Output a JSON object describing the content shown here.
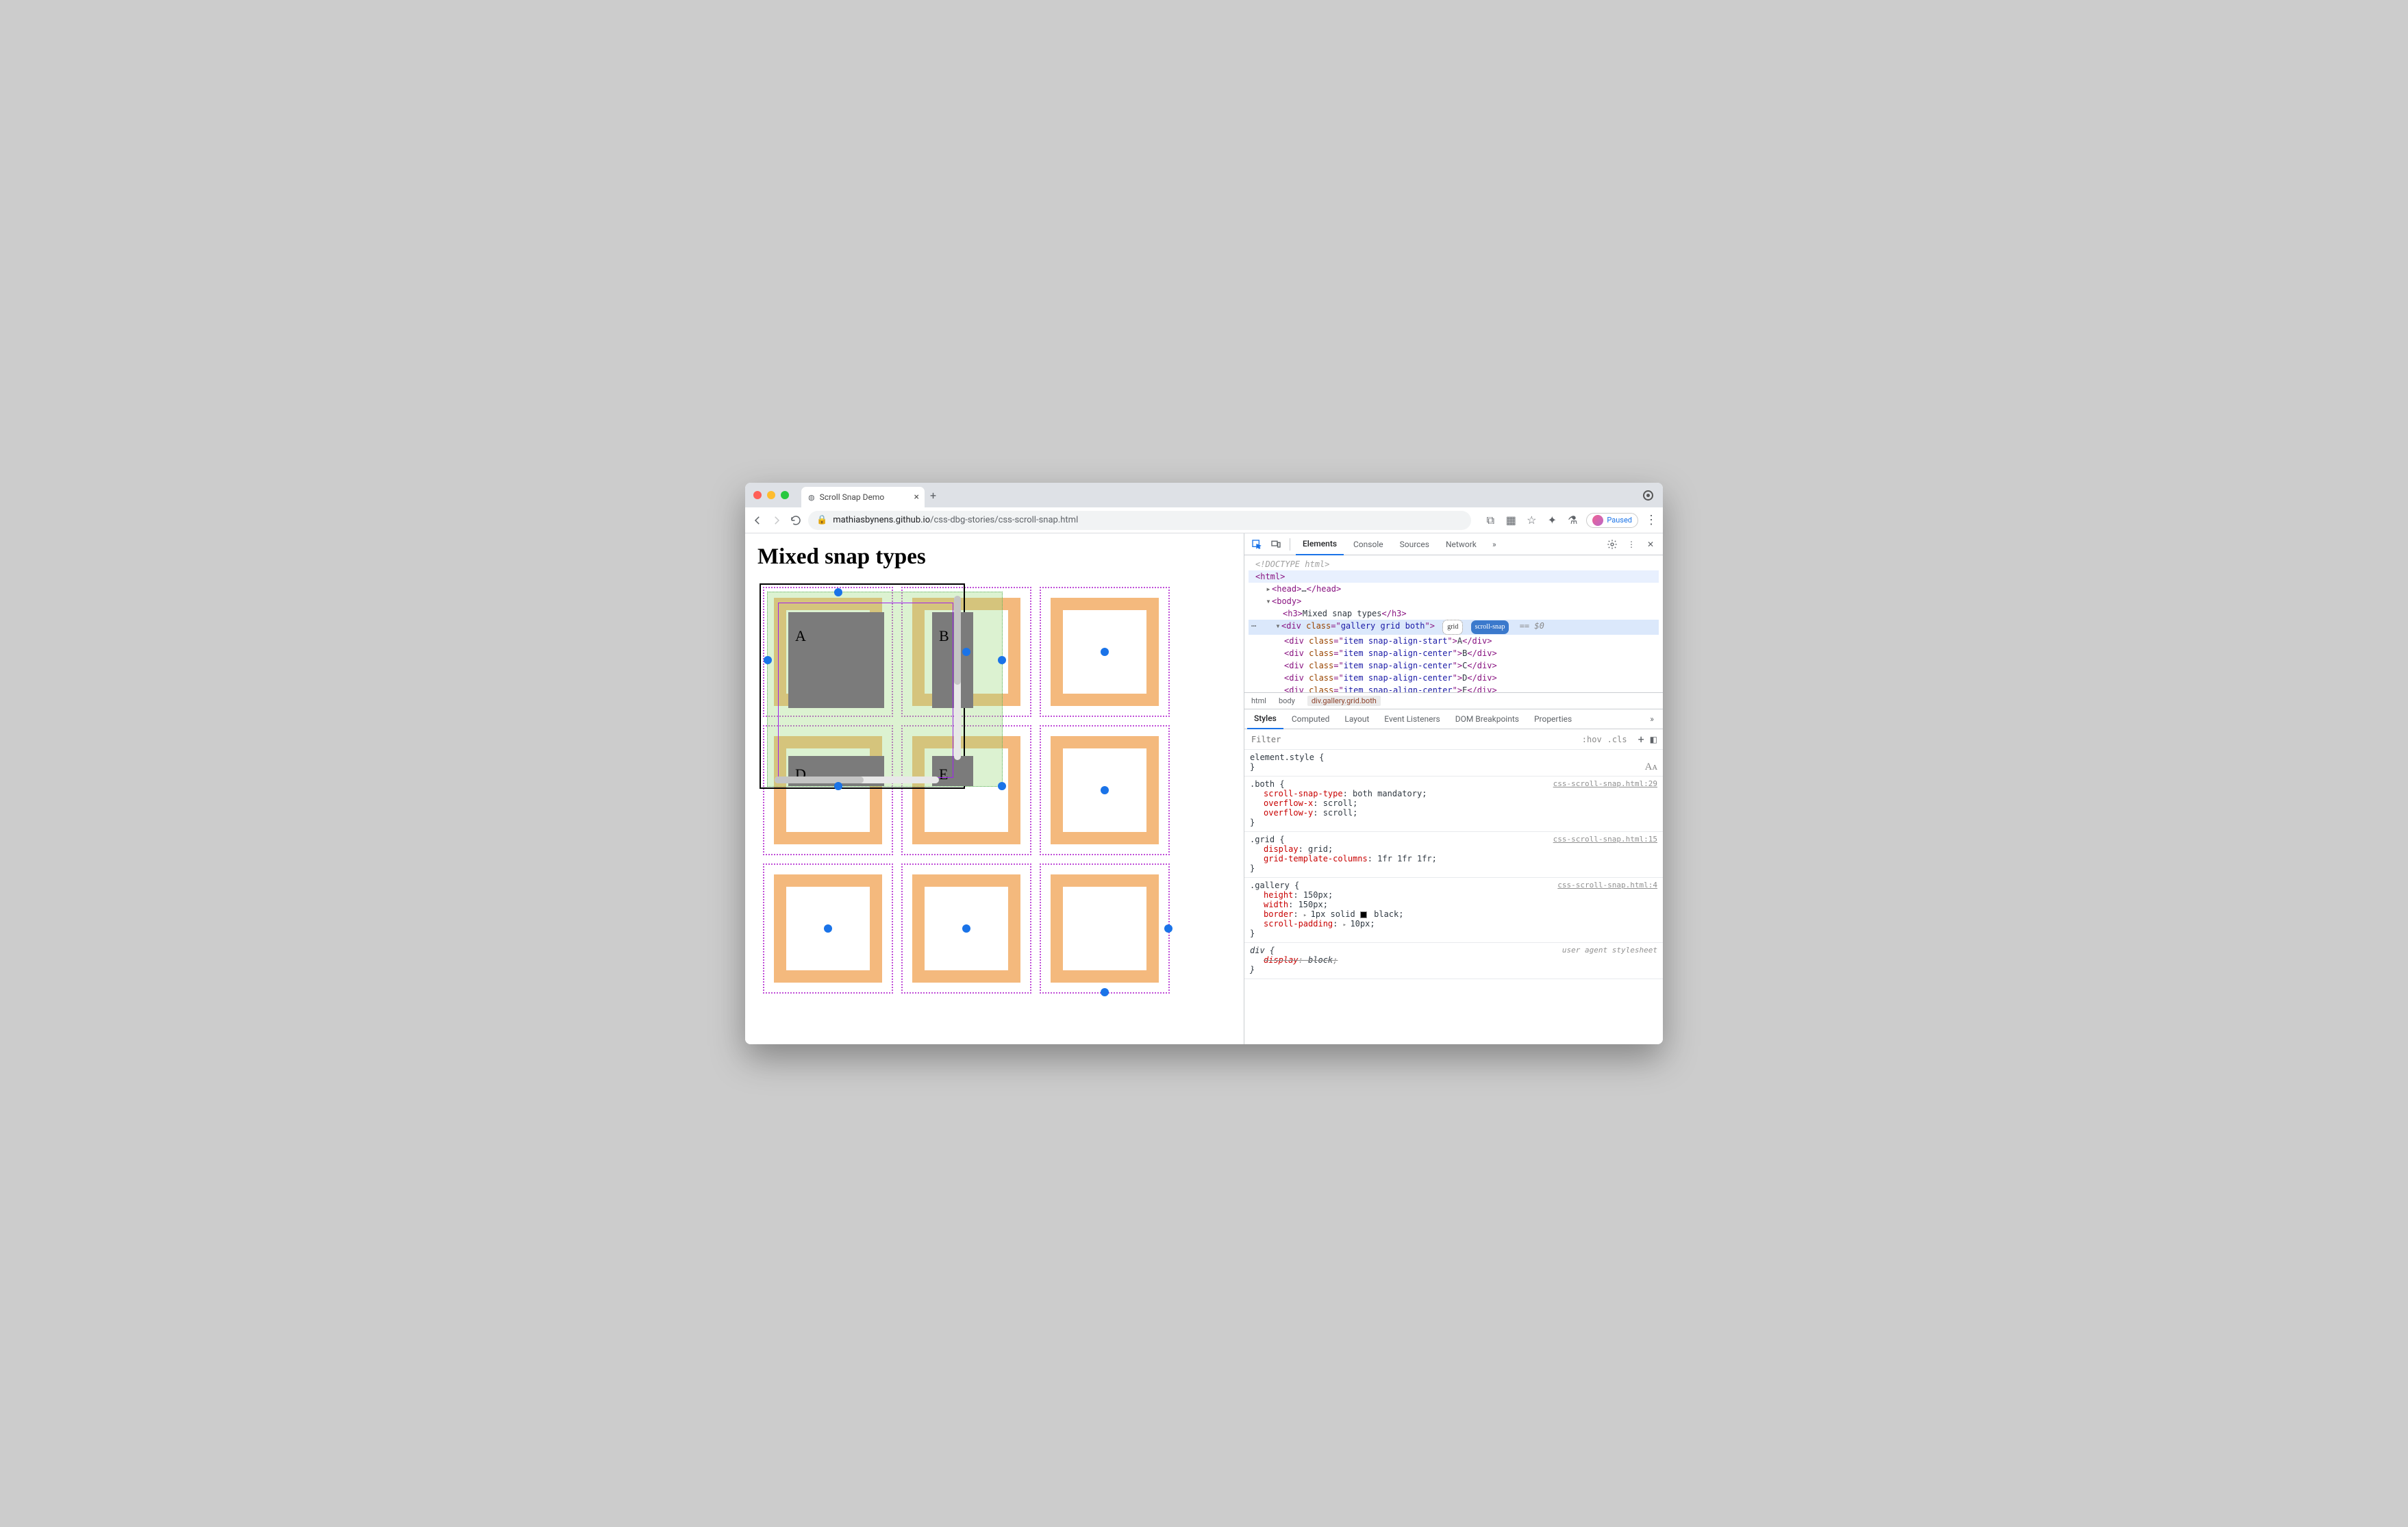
{
  "browser": {
    "tab_title": "Scroll Snap Demo",
    "url_domain": "mathiasbynens.github.io",
    "url_path": "/css-dbg-stories/css-scroll-snap.html",
    "paused_label": "Paused"
  },
  "page": {
    "heading": "Mixed snap types",
    "items": [
      "A",
      "B",
      "D",
      "E"
    ]
  },
  "devtools": {
    "tabs": [
      "Elements",
      "Console",
      "Sources",
      "Network"
    ],
    "doctype": "<!DOCTYPE html>",
    "dom": {
      "html_open": "<html>",
      "head": {
        "open": "<head>",
        "close": "</head>",
        "ellipsis": "…"
      },
      "body_open": "<body>",
      "h3_open": "<h3>",
      "h3_text": "Mixed snap types",
      "h3_close": "</h3>",
      "sel_div_open_prefix": "<div ",
      "sel_class_attr": "class",
      "sel_class_val": "gallery grid both",
      "badge_grid": "grid",
      "badge_snap": "scroll-snap",
      "eq0": "== $0",
      "children": [
        {
          "cls": "item snap-align-start",
          "text": "A"
        },
        {
          "cls": "item snap-align-center",
          "text": "B"
        },
        {
          "cls": "item snap-align-center",
          "text": "C"
        },
        {
          "cls": "item snap-align-center",
          "text": "D"
        },
        {
          "cls": "item snap-align-center",
          "text": "E"
        }
      ]
    },
    "crumbs": [
      "html",
      "body",
      "div.gallery.grid.both"
    ],
    "sub_tabs": [
      "Styles",
      "Computed",
      "Layout",
      "Event Listeners",
      "DOM Breakpoints",
      "Properties"
    ],
    "filter": {
      "placeholder": "Filter",
      "hov": ":hov",
      "cls": ".cls"
    },
    "rules": [
      {
        "selector": "element.style {",
        "source": "",
        "decls": [],
        "close": "}"
      },
      {
        "selector": ".both {",
        "source": "css-scroll-snap.html:29",
        "decls": [
          {
            "p": "scroll-snap-type",
            "v": "both mandatory"
          },
          {
            "p": "overflow-x",
            "v": "scroll"
          },
          {
            "p": "overflow-y",
            "v": "scroll"
          }
        ],
        "close": "}"
      },
      {
        "selector": ".grid {",
        "source": "css-scroll-snap.html:15",
        "decls": [
          {
            "p": "display",
            "v": "grid"
          },
          {
            "p": "grid-template-columns",
            "v": "1fr 1fr 1fr"
          }
        ],
        "close": "}"
      },
      {
        "selector": ".gallery {",
        "source": "css-scroll-snap.html:4",
        "decls": [
          {
            "p": "height",
            "v": "150px"
          },
          {
            "p": "width",
            "v": "150px"
          },
          {
            "p": "border",
            "v": "1px solid ■ black",
            "tri": true
          },
          {
            "p": "scroll-padding",
            "v": "10px",
            "tri": true
          }
        ],
        "close": "}"
      },
      {
        "selector": "div {",
        "source": "user agent stylesheet",
        "ua": true,
        "decls": [
          {
            "p": "display",
            "v": "block"
          }
        ],
        "close": "}"
      }
    ]
  }
}
